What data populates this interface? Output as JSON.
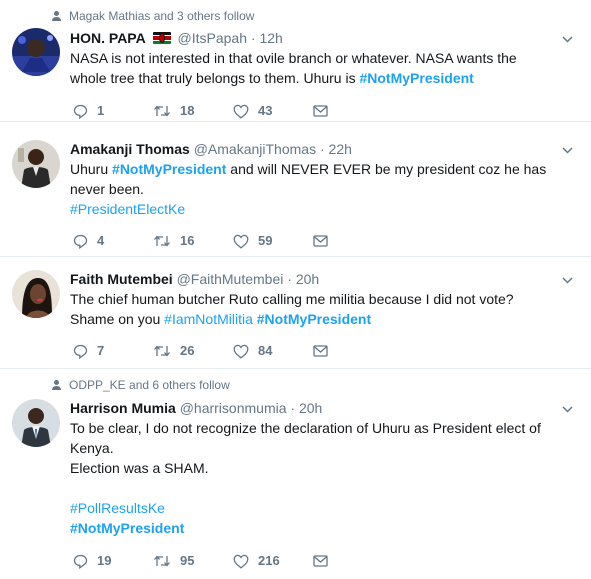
{
  "tweets": [
    {
      "social_context": "Magak Mathias and 3 others follow",
      "name": "HON. PAPA",
      "handle": "@ItsPapah",
      "time": "12h",
      "text_parts": [
        {
          "t": "NASA is not interested in that ovile branch or whatever. NASA wants the whole tree that truly belongs to them. Uhuru is "
        },
        {
          "t": "#NotMyPresident",
          "tag": true,
          "bold": true
        }
      ],
      "replies": "1",
      "retweets": "18",
      "likes": "43"
    },
    {
      "name": "Amakanji Thomas",
      "handle": "@AmakanjiThomas",
      "time": "22h",
      "text_parts": [
        {
          "t": "Uhuru "
        },
        {
          "t": "#NotMyPresident",
          "tag": true,
          "bold": true
        },
        {
          "t": " and will NEVER EVER be my president coz he has never been."
        },
        {
          "br": true
        },
        {
          "t": "#PresidentElectKe",
          "tag": true
        }
      ],
      "replies": "4",
      "retweets": "16",
      "likes": "59"
    },
    {
      "name": "Faith Mutembei",
      "handle": "@FaithMutembei",
      "time": "20h",
      "text_parts": [
        {
          "t": "The chief human butcher Ruto calling me militia because I did not vote? Shame on you "
        },
        {
          "t": "#IamNotMilitia",
          "tag": true
        },
        {
          "t": " "
        },
        {
          "t": "#NotMyPresident",
          "tag": true,
          "bold": true
        }
      ],
      "replies": "7",
      "retweets": "26",
      "likes": "84"
    },
    {
      "social_context": "ODPP_KE and 6 others follow",
      "name": "Harrison Mumia",
      "handle": "@harrisonmumia",
      "time": "20h",
      "text_parts": [
        {
          "t": "To be clear, I do not recognize the declaration of Uhuru as President elect of Kenya."
        },
        {
          "br": true
        },
        {
          "t": "Election was a SHAM."
        },
        {
          "br": true
        },
        {
          "br": true
        },
        {
          "t": "#PollResultsKe",
          "tag": true
        },
        {
          "br": true
        },
        {
          "t": "#NotMyPresident",
          "tag": true,
          "bold": true
        }
      ],
      "replies": "19",
      "retweets": "95",
      "likes": "216"
    }
  ],
  "colors": {
    "accent": "#1da1f2",
    "muted": "#657786",
    "divider": "#e6ecf0"
  },
  "icons": [
    "person-icon",
    "reply-icon",
    "retweet-icon",
    "like-icon",
    "message-icon",
    "chevron-down-icon",
    "kenya-flag-icon"
  ]
}
